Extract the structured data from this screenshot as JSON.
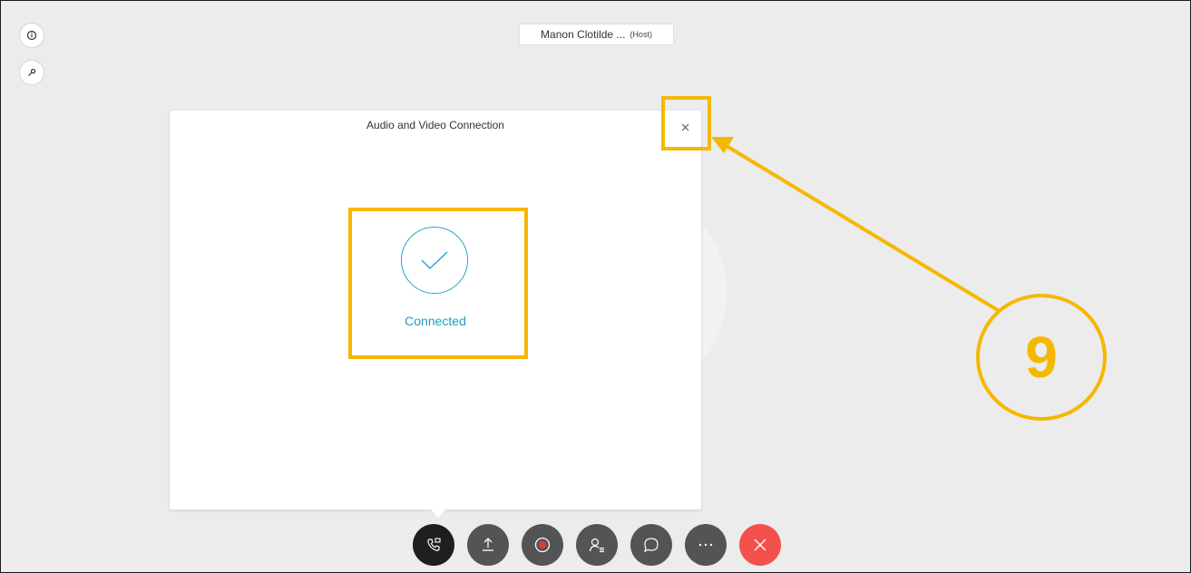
{
  "host": {
    "name": "Manon Clotilde ...",
    "role": "(Host)"
  },
  "dialog": {
    "title": "Audio and Video Connection",
    "status": "Connected"
  },
  "annotation": {
    "step_number": "9"
  },
  "toolbar": {
    "buttons": [
      {
        "name": "audio-video-connection",
        "icon": "phone-video-icon",
        "active": true
      },
      {
        "name": "share",
        "icon": "upload-icon"
      },
      {
        "name": "record",
        "icon": "record-icon"
      },
      {
        "name": "participants",
        "icon": "participants-icon"
      },
      {
        "name": "chat",
        "icon": "chat-bubble-icon"
      },
      {
        "name": "more-options",
        "icon": "more-dots-icon"
      },
      {
        "name": "leave-meeting",
        "icon": "close-icon"
      }
    ]
  },
  "colors": {
    "accent": "#1f9bc4",
    "annotation": "#f5b800",
    "end_call": "#f2514e",
    "record_dot": "#e53935"
  }
}
